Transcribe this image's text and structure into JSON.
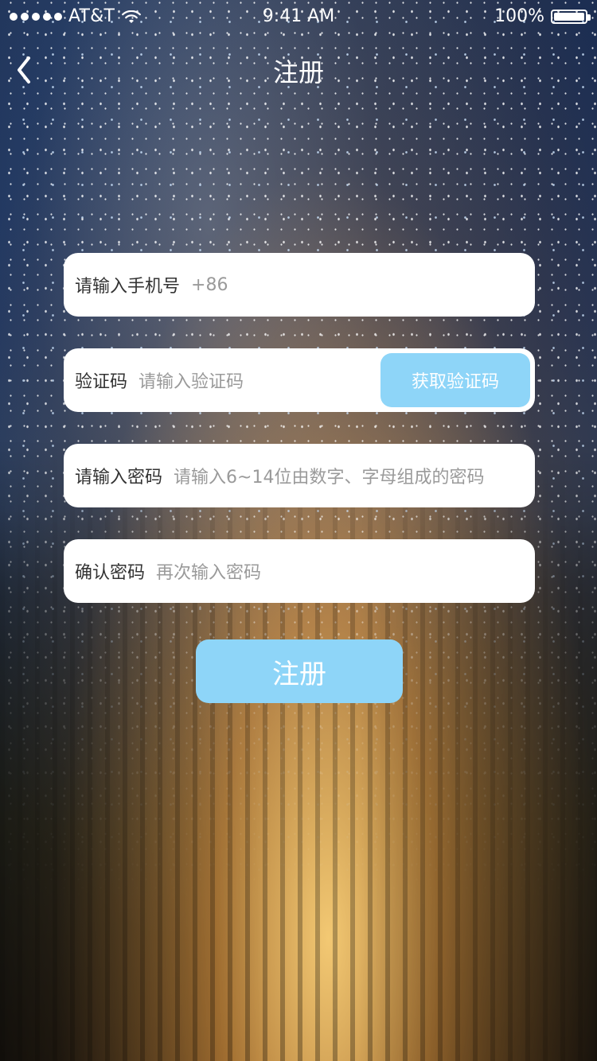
{
  "status_bar": {
    "carrier": "AT&T",
    "time": "9:41 AM",
    "battery_percent": "100%",
    "signal_bars": 5,
    "icons": [
      "signal-dots-icon",
      "wifi-icon",
      "battery-icon"
    ]
  },
  "nav": {
    "title": "注册",
    "back_icon": "chevron-left-icon"
  },
  "form": {
    "phone": {
      "label": "请输入手机号",
      "placeholder": "+86"
    },
    "code": {
      "label": "验证码",
      "placeholder": "请输入验证码",
      "button_label": "获取验证码"
    },
    "password": {
      "label": "请输入密码",
      "placeholder": "请输入6~14位由数字、字母组成的密码"
    },
    "confirm_password": {
      "label": "确认密码",
      "placeholder": "再次输入密码"
    },
    "submit_label": "注册"
  },
  "colors": {
    "accent": "#8ed5f8",
    "field_bg": "#ffffff",
    "label_text": "#333333",
    "placeholder_text": "#9a9a9a"
  }
}
